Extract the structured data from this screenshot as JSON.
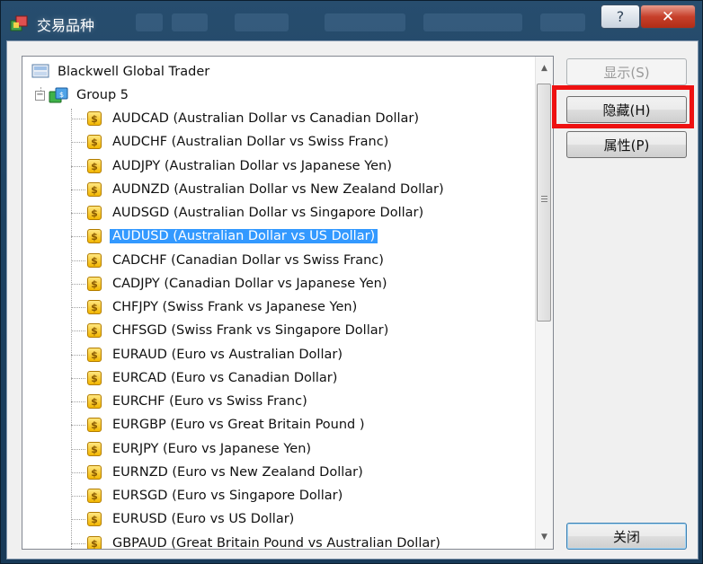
{
  "window": {
    "title": "交易品种",
    "help_label": "?",
    "close_label": "✕"
  },
  "tree": {
    "root": "Blackwell Global Trader",
    "group": "Group 5",
    "selected_index": 5,
    "items": [
      "AUDCAD  (Australian Dollar vs Canadian Dollar)",
      "AUDCHF  (Australian Dollar vs Swiss Franc)",
      "AUDJPY  (Australian Dollar vs Japanese Yen)",
      "AUDNZD  (Australian Dollar vs New Zealand Dollar)",
      "AUDSGD  (Australian Dollar vs Singapore Dollar)",
      "AUDUSD  (Australian Dollar vs US Dollar)",
      "CADCHF  (Canadian Dollar vs Swiss Franc)",
      "CADJPY  (Canadian Dollar vs Japanese Yen)",
      "CHFJPY  (Swiss Frank vs Japanese Yen)",
      "CHFSGD  (Swiss Frank vs Singapore Dollar)",
      "EURAUD  (Euro vs Australian Dollar)",
      "EURCAD  (Euro vs Canadian Dollar)",
      "EURCHF  (Euro vs Swiss Franc)",
      "EURGBP  (Euro vs Great Britain Pound )",
      "EURJPY  (Euro vs Japanese Yen)",
      "EURNZD  (Euro vs New Zealand Dollar)",
      "EURSGD  (Euro vs Singapore Dollar)",
      "EURUSD  (Euro vs US Dollar)",
      "GBPAUD  (Great Britain Pound vs Australian Dollar)"
    ]
  },
  "buttons": {
    "show": "显示(S)",
    "hide": "隐藏(H)",
    "properties": "属性(P)",
    "close": "关闭"
  },
  "icons": {
    "title": "window-app-icon",
    "root": "server-icon",
    "group": "folder-group-icon",
    "symbol": "dollar-coin-icon"
  }
}
